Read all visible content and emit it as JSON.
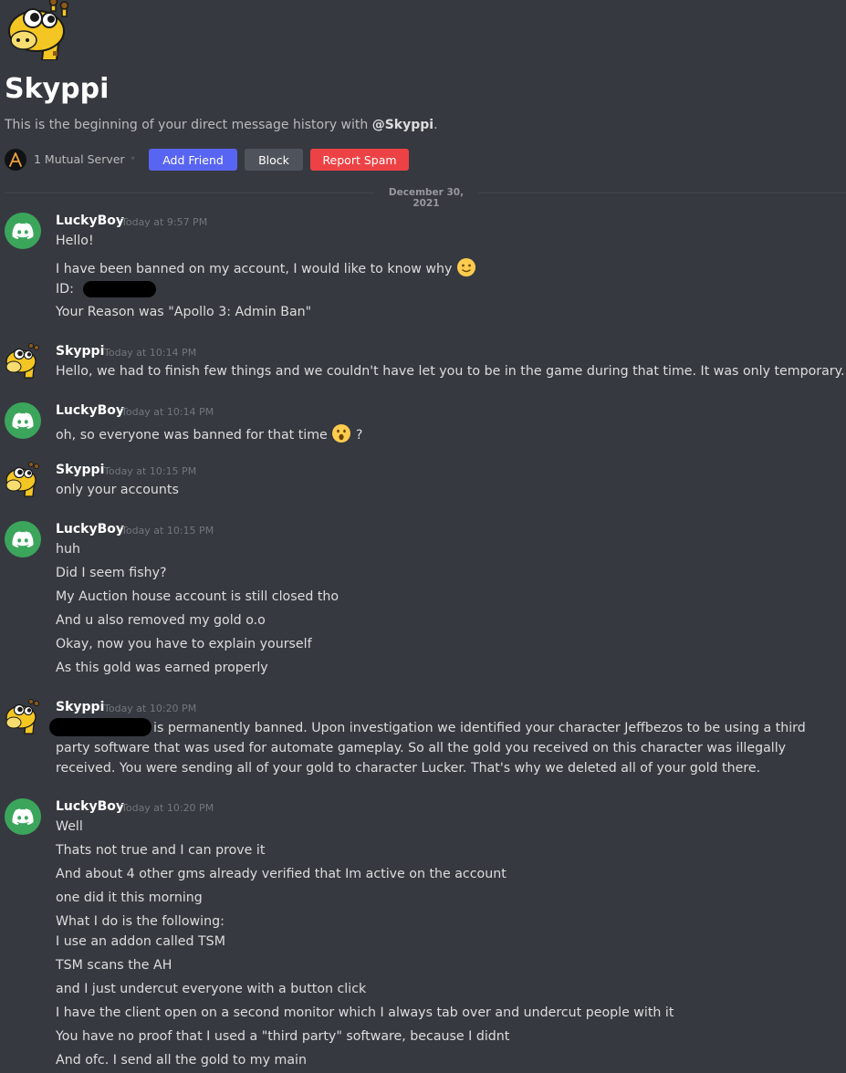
{
  "profile": {
    "name": "Skyppi",
    "intro_prefix": "This is the beginning of your direct message history with ",
    "intro_handle": "@Skyppi",
    "intro_suffix": ".",
    "mutual_servers": "1 Mutual Server",
    "separator": "•",
    "buttons": {
      "add_friend": "Add Friend",
      "block": "Block",
      "report_spam": "Report Spam"
    }
  },
  "date_divider": "December 30, 2021",
  "colors": {
    "background": "#36393f",
    "blurple": "#5865f2",
    "danger": "#ed4245",
    "discord_green": "#3ba55c"
  },
  "messages": [
    {
      "author": "LuckyBoy",
      "time": "Today at 9:57 PM",
      "lines": [
        "Hello!",
        "I have been banned on my account, I would like to know why",
        "ID:",
        "Your Reason was \"Apollo 3: Admin Ban\""
      ]
    },
    {
      "author": "Skyppi",
      "time": "Today at 10:14 PM",
      "lines": [
        "Hello, we had to finish few things and we couldn't have let you to be in the game during that time. It was only temporary."
      ]
    },
    {
      "author": "LuckyBoy",
      "time": "Today at 10:14 PM",
      "lines": [
        "oh, so everyone was banned for that time",
        "?"
      ]
    },
    {
      "author": "Skyppi",
      "time": "Today at 10:15 PM",
      "lines": [
        "only your accounts"
      ]
    },
    {
      "author": "LuckyBoy",
      "time": "Today at 10:15 PM",
      "lines": [
        "huh",
        "Did I seem fishy?",
        "My Auction house account is still closed tho",
        "And u also removed my gold o.o",
        "Okay, now you have to explain yourself",
        "As this gold was earned properly"
      ]
    },
    {
      "author": "Skyppi",
      "time": "Today at 10:20 PM",
      "lines": [
        "is permanently banned. Upon investigation we identified your character Jeffbezos to be using a third party software that was used for automate gameplay. So all the gold you received on this character was illegally received. You were sending all of your gold to character Lucker. That's why we deleted all of your gold there."
      ]
    },
    {
      "author": "LuckyBoy",
      "time": "Today at 10:20 PM",
      "lines": [
        "Well",
        "Thats not true and I can prove it",
        "And about 4 other gms already verified that Im active on the account",
        "one did it this morning",
        "What I do is the following:",
        "I use an addon called TSM",
        "TSM scans the AH",
        "and I just undercut everyone with a button click",
        "I have the client open on a second monitor which I always tab over and undercut people with it",
        "You have no proof that I used a \"third party\" software, because I didnt",
        "And ofc. I send all the gold to my main"
      ]
    }
  ]
}
